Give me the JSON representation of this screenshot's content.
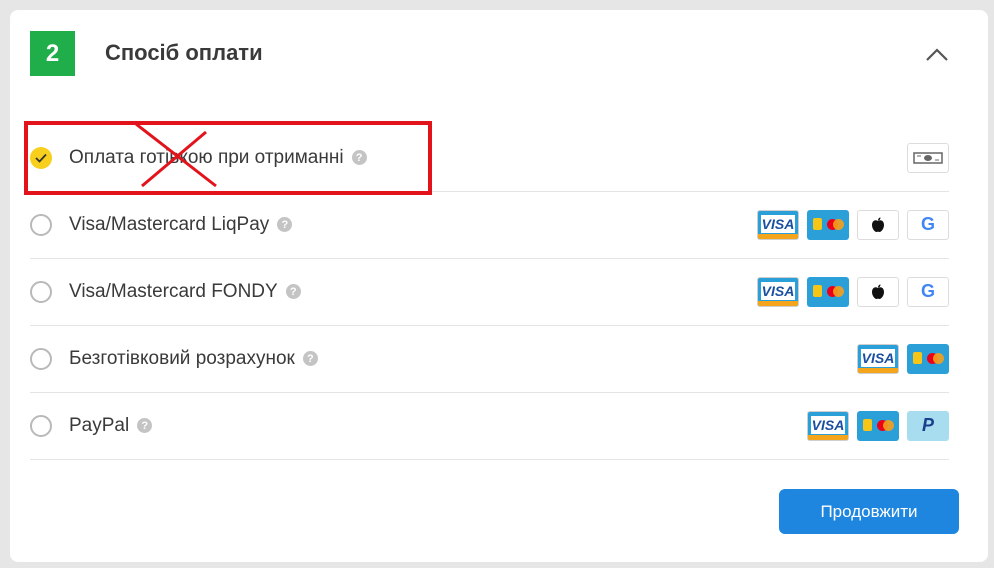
{
  "step": {
    "number": "2"
  },
  "title": "Спосіб оплати",
  "accent_colors": {
    "step": "#1fae4a",
    "selected": "#f7cf1c",
    "button": "#1f86e0",
    "annotation": "#e3131b"
  },
  "options": [
    {
      "label": "Оплата готівкою при отриманні",
      "selected": true,
      "help": "?",
      "icons": [
        "cash-icon"
      ]
    },
    {
      "label": "Visa/Mastercard LiqPay",
      "selected": false,
      "help": "?",
      "icons": [
        "visa-icon",
        "mastercard-icon",
        "apple-pay-icon",
        "google-pay-icon"
      ]
    },
    {
      "label": "Visa/Mastercard FONDY",
      "selected": false,
      "help": "?",
      "icons": [
        "visa-icon",
        "mastercard-icon",
        "apple-pay-icon",
        "google-pay-icon"
      ]
    },
    {
      "label": "Безготівковий розрахунок",
      "selected": false,
      "help": "?",
      "icons": [
        "visa-icon",
        "mastercard-icon"
      ]
    },
    {
      "label": "PayPal",
      "selected": false,
      "help": "?",
      "icons": [
        "visa-icon",
        "mastercard-icon",
        "paypal-icon"
      ]
    }
  ],
  "icon_text": {
    "visa": "VISA",
    "paypal": "P",
    "google": "G"
  },
  "continue_button": "Продовжити"
}
